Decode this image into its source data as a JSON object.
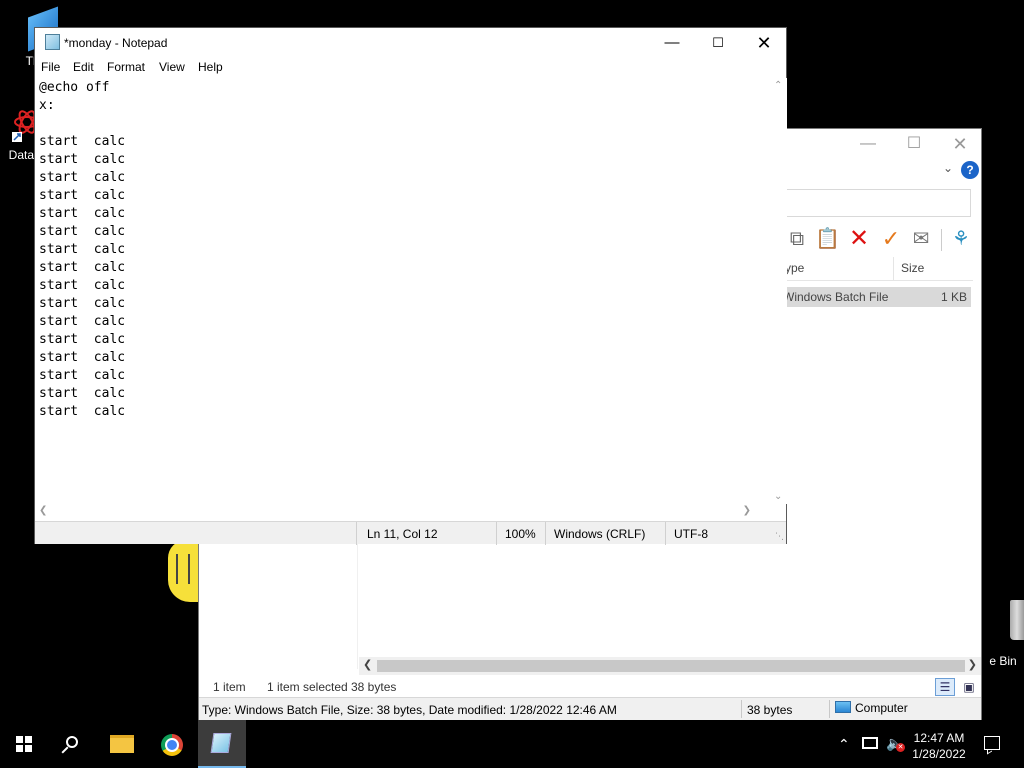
{
  "desktop": {
    "this_pc_label": "Thi",
    "dataw_label": "DataW",
    "recycle_label": "e Bin"
  },
  "explorer": {
    "column_type": "ype",
    "column_size": "Size",
    "file_row": {
      "type": "Windows Batch File",
      "size": "1 KB"
    },
    "status": {
      "items": "1 item",
      "selected": "1 item selected",
      "bytes": "38 bytes"
    },
    "detail_bar": {
      "text": "Type: Windows Batch File, Size: 38 bytes, Date modified: 1/28/2022 12:46 AM",
      "size": "38 bytes",
      "location": "Computer"
    }
  },
  "notepad": {
    "title": "*monday - Notepad",
    "menu": [
      "File",
      "Edit",
      "Format",
      "View",
      "Help"
    ],
    "content": "@echo off\nx:\n\nstart  calc\nstart  calc\nstart  calc\nstart  calc\nstart  calc\nstart  calc\nstart  calc\nstart  calc\nstart  calc\nstart  calc\nstart  calc\nstart  calc\nstart  calc\nstart  calc\nstart  calc\nstart  calc",
    "status": {
      "position": "Ln 11, Col 12",
      "zoom": "100%",
      "line_endings": "Windows (CRLF)",
      "encoding": "UTF-8"
    }
  },
  "taskbar": {
    "time": "12:47 AM",
    "date": "1/28/2022",
    "pinned": [
      "file-explorer",
      "google-chrome",
      "notepad"
    ],
    "active_app": "notepad",
    "accent": "#76b9ed"
  },
  "colors": {
    "desktop_bg": "#000000",
    "status_bg": "#f0f0f0",
    "delete_red": "#dd1111",
    "check_orange": "#e5791d",
    "help_blue": "#1b64c8"
  }
}
